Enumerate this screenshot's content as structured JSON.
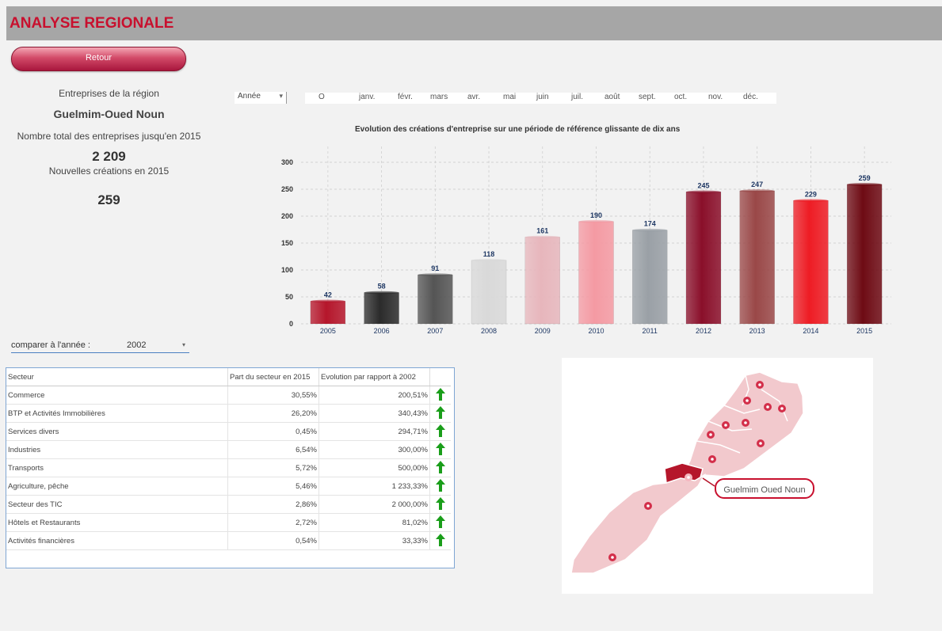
{
  "header": {
    "title": "ANALYSE REGIONALE"
  },
  "retour_label": "Retour",
  "kpi": {
    "line1": "Entreprises de la région",
    "region": "Guelmim-Oued Noun",
    "total_label": "Nombre total des entreprises jusqu'en 2015",
    "total_value": "2 209",
    "new_label": "Nouvelles créations en 2015",
    "new_value": "259"
  },
  "filters": {
    "year_label": "Année",
    "months": [
      "O",
      "janv.",
      "févr.",
      "mars",
      "avr.",
      "mai",
      "juin",
      "juil.",
      "août",
      "sept.",
      "oct.",
      "nov.",
      "déc."
    ]
  },
  "chart_data": {
    "type": "bar",
    "title": "Evolution des créations d'entreprise sur une période de référence glissante de dix ans",
    "categories": [
      "2005",
      "2006",
      "2007",
      "2008",
      "2009",
      "2010",
      "2011",
      "2012",
      "2013",
      "2014",
      "2015"
    ],
    "values": [
      42,
      58,
      91,
      118,
      161,
      190,
      174,
      245,
      247,
      229,
      259
    ],
    "ylim": [
      0,
      300
    ],
    "yticks": [
      0,
      50,
      100,
      150,
      200,
      250,
      300
    ],
    "colors": [
      "#b5162b",
      "#2b2b2b",
      "#555555",
      "#d9d9d9",
      "#e7b6bc",
      "#f49aa3",
      "#9aa0a6",
      "#8a0f2a",
      "#9a4848",
      "#ee1c24",
      "#6e0b14"
    ],
    "grid": true
  },
  "compare": {
    "label": "comparer à l'année :",
    "value": "2002"
  },
  "table": {
    "headers": [
      "Secteur",
      "Part du secteur en 2015",
      "Evolution par rapport à 2002"
    ],
    "rows": [
      {
        "sector": "Commerce",
        "share": "30,55%",
        "evolution": "200,51%"
      },
      {
        "sector": "BTP et Activités Immobilières",
        "share": "26,20%",
        "evolution": "340,43%"
      },
      {
        "sector": "Services divers",
        "share": "0,45%",
        "evolution": "294,71%"
      },
      {
        "sector": "Industries",
        "share": "6,54%",
        "evolution": "300,00%"
      },
      {
        "sector": "Transports",
        "share": "5,72%",
        "evolution": "500,00%"
      },
      {
        "sector": "Agriculture, pêche",
        "share": "5,46%",
        "evolution": "1 233,33%"
      },
      {
        "sector": "Secteur des TIC",
        "share": "2,86%",
        "evolution": "2 000,00%"
      },
      {
        "sector": "Hôtels et Restaurants",
        "share": "2,72%",
        "evolution": "81,02%"
      },
      {
        "sector": "Activités financières",
        "share": "0,54%",
        "evolution": "33,33%"
      }
    ],
    "arrow_color": "#1a9e1a"
  },
  "map": {
    "callout": "Guelmim Oued Noun",
    "highlight_color": "#b5162b",
    "region_color": "#f2c9cd"
  }
}
